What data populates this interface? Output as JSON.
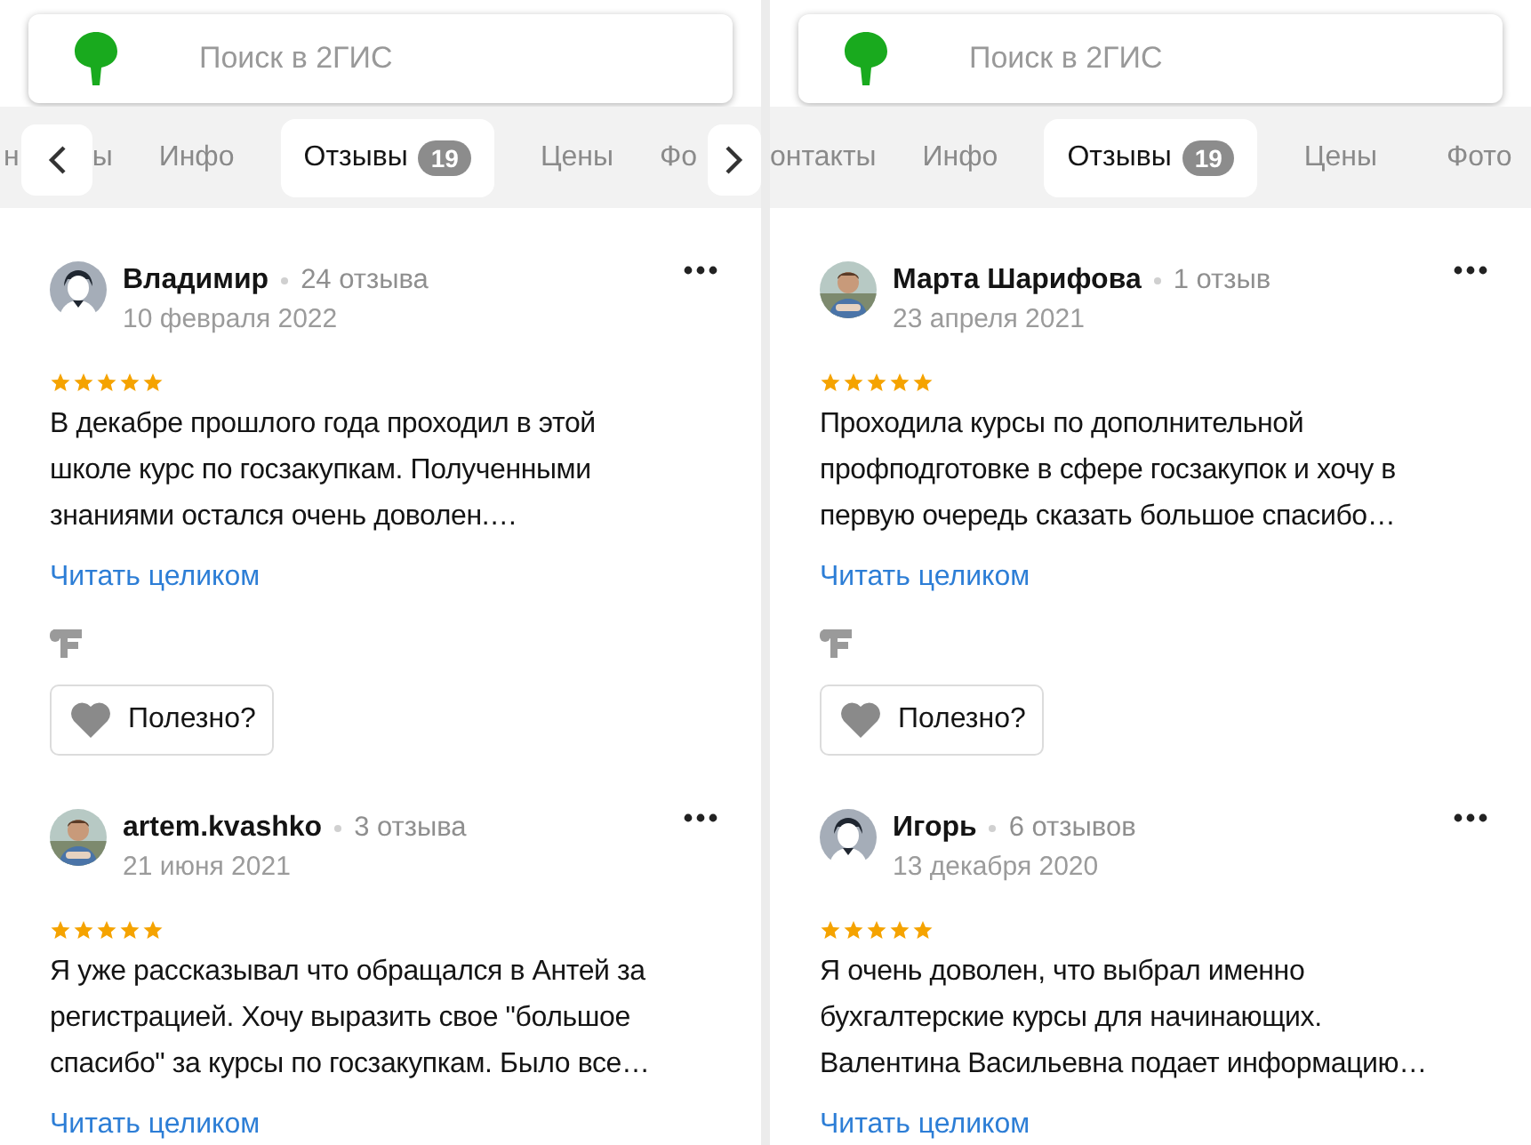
{
  "panels": [
    {
      "search": {
        "placeholder": "Поиск в 2ГИС"
      },
      "nav_prev": true,
      "nav_next": true,
      "tabs": [
        {
          "label": "н",
          "kind": "partial",
          "selected": false
        },
        {
          "label": "ы",
          "kind": "partial",
          "selected": false
        },
        {
          "label": "Инфо",
          "kind": "full",
          "selected": false
        },
        {
          "label": "Отзывы",
          "kind": "full",
          "badge": "19",
          "selected": true
        },
        {
          "label": "Цены",
          "kind": "full",
          "selected": false
        },
        {
          "label": "Фо",
          "kind": "partial",
          "selected": false
        }
      ],
      "reviews": [
        {
          "author": "Владимир",
          "count": "24 отзыва",
          "date": "10 февраля 2022",
          "avatar": {
            "kind": "silhouette"
          },
          "stars": 5,
          "text": "В декабре прошлого года проходил в этой\nшколе курс по госзакупкам. Полученными\nзнаниями остался очень доволен.…",
          "read_more": "Читать целиком",
          "source_mark": true,
          "helpful": "Полезно?"
        },
        {
          "author": "artem.kvashko",
          "count": "3 отзыва",
          "date": "21 июня 2021",
          "stars": 5,
          "text": "Я уже рассказывал что обращался в Антей за\nрегистрацией. Хочу выразить свое \"большое\nспасибо\" за курсы по госзакупкам. Было все…",
          "read_more": "Читать целиком"
        }
      ]
    },
    {
      "search": {
        "placeholder": "Поиск в 2ГИС"
      },
      "tabs": [
        {
          "label": "онтакты",
          "kind": "partial",
          "selected": false
        },
        {
          "label": "Инфо",
          "kind": "full",
          "selected": false
        },
        {
          "label": "Отзывы",
          "kind": "full",
          "badge": "19",
          "selected": true
        },
        {
          "label": "Цены",
          "kind": "full",
          "selected": false
        },
        {
          "label": "Фото",
          "kind": "full",
          "selected": false
        }
      ],
      "reviews": [
        {
          "author": "Марта Шарифова",
          "count": "1 отзыв",
          "date": "23 апреля 2021",
          "stars": 5,
          "text": "Проходила курсы по дополнительной\nпрофподготовке в сфере госзакупок и хочу в\nпервую очередь сказать большое спасибо…",
          "read_more": "Читать целиком",
          "source_mark": true,
          "helpful": "Полезно?"
        },
        {
          "author": "Игорь",
          "count": "6 отзывов",
          "date": "13 декабря 2020",
          "avatar": {
            "kind": "silhouette"
          },
          "stars": 5,
          "text": "Я очень доволен, что выбрал именно\nбухгалтерские курсы для начинающих.\nВалентина Васильевна подает информацию…",
          "read_more": "Читать целиком"
        }
      ]
    }
  ]
}
